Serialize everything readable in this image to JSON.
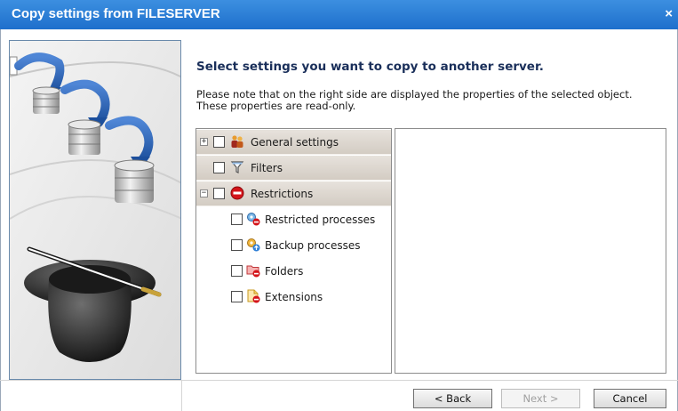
{
  "window": {
    "title": "Copy settings from FILESERVER",
    "close_symbol": "×"
  },
  "content": {
    "heading": "Select settings you want to copy to another server.",
    "note_line1": "Please note that on the right side are displayed the properties of the selected object.",
    "note_line2": "These properties are read-only."
  },
  "tree": {
    "general": {
      "label": "General settings",
      "expander": "+",
      "icon": "users-icon"
    },
    "filters": {
      "label": "Filters",
      "icon": "filter-icon"
    },
    "restrictions": {
      "label": "Restrictions",
      "expander": "−",
      "icon": "no-entry-icon"
    },
    "restricted_processes": {
      "label": "Restricted processes",
      "icon": "restricted-processes-icon"
    },
    "backup_processes": {
      "label": "Backup processes",
      "icon": "backup-processes-icon"
    },
    "folders": {
      "label": "Folders",
      "icon": "restricted-folder-icon"
    },
    "extensions": {
      "label": "Extensions",
      "icon": "restricted-extension-icon"
    }
  },
  "buttons": {
    "back": "< Back",
    "next": "Next >",
    "cancel": "Cancel"
  },
  "colors": {
    "titlebar": "#2a7fd8",
    "heading": "#1a2f5a",
    "group_row": "#ddd6ce"
  }
}
